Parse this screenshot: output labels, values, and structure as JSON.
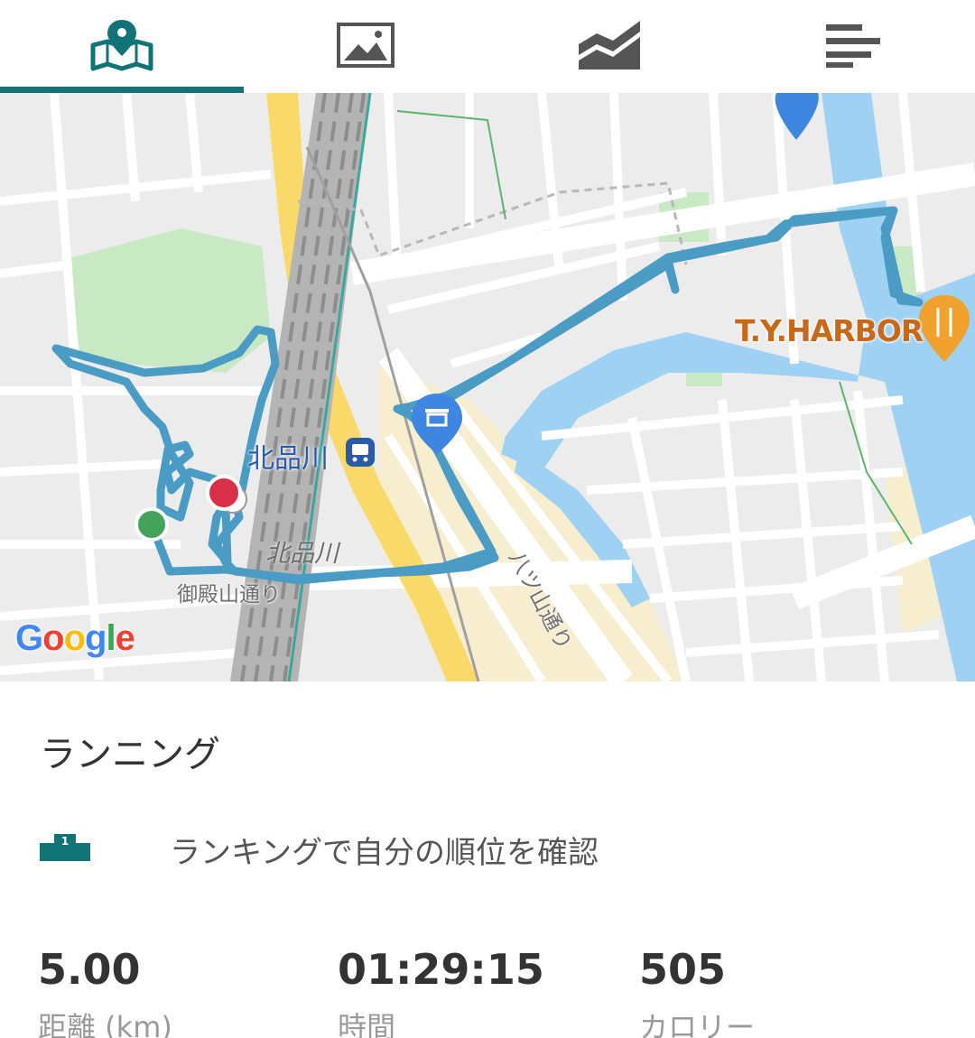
{
  "tabs": [
    {
      "name": "map-icon",
      "active": true
    },
    {
      "name": "photo-icon",
      "active": false
    },
    {
      "name": "chart-icon",
      "active": false
    },
    {
      "name": "details-icon",
      "active": false
    }
  ],
  "colors": {
    "accent": "#127377",
    "route": "#4a9cc4",
    "start_marker": "#43a35a",
    "end_marker": "#d9304a",
    "water": "#9ed1f2"
  },
  "map": {
    "station_label": "北品川",
    "station_rail_label": "北品川",
    "street_label_1": "御殿山通り",
    "street_label_2": "八ツ山通り",
    "poi_label": "T.Y.HARBOR",
    "google_letters": [
      "G",
      "o",
      "o",
      "g",
      "l",
      "e"
    ]
  },
  "activity": {
    "title": "ランニング",
    "ranking_icon_number": "1",
    "ranking_text": "ランキングで自分の順位を確認"
  },
  "stats": {
    "distance": {
      "value": "5.00",
      "label": "距離 (km)"
    },
    "time": {
      "value": "01:29:15",
      "label": "時間"
    },
    "calories": {
      "value": "505",
      "label": "カロリー"
    }
  }
}
